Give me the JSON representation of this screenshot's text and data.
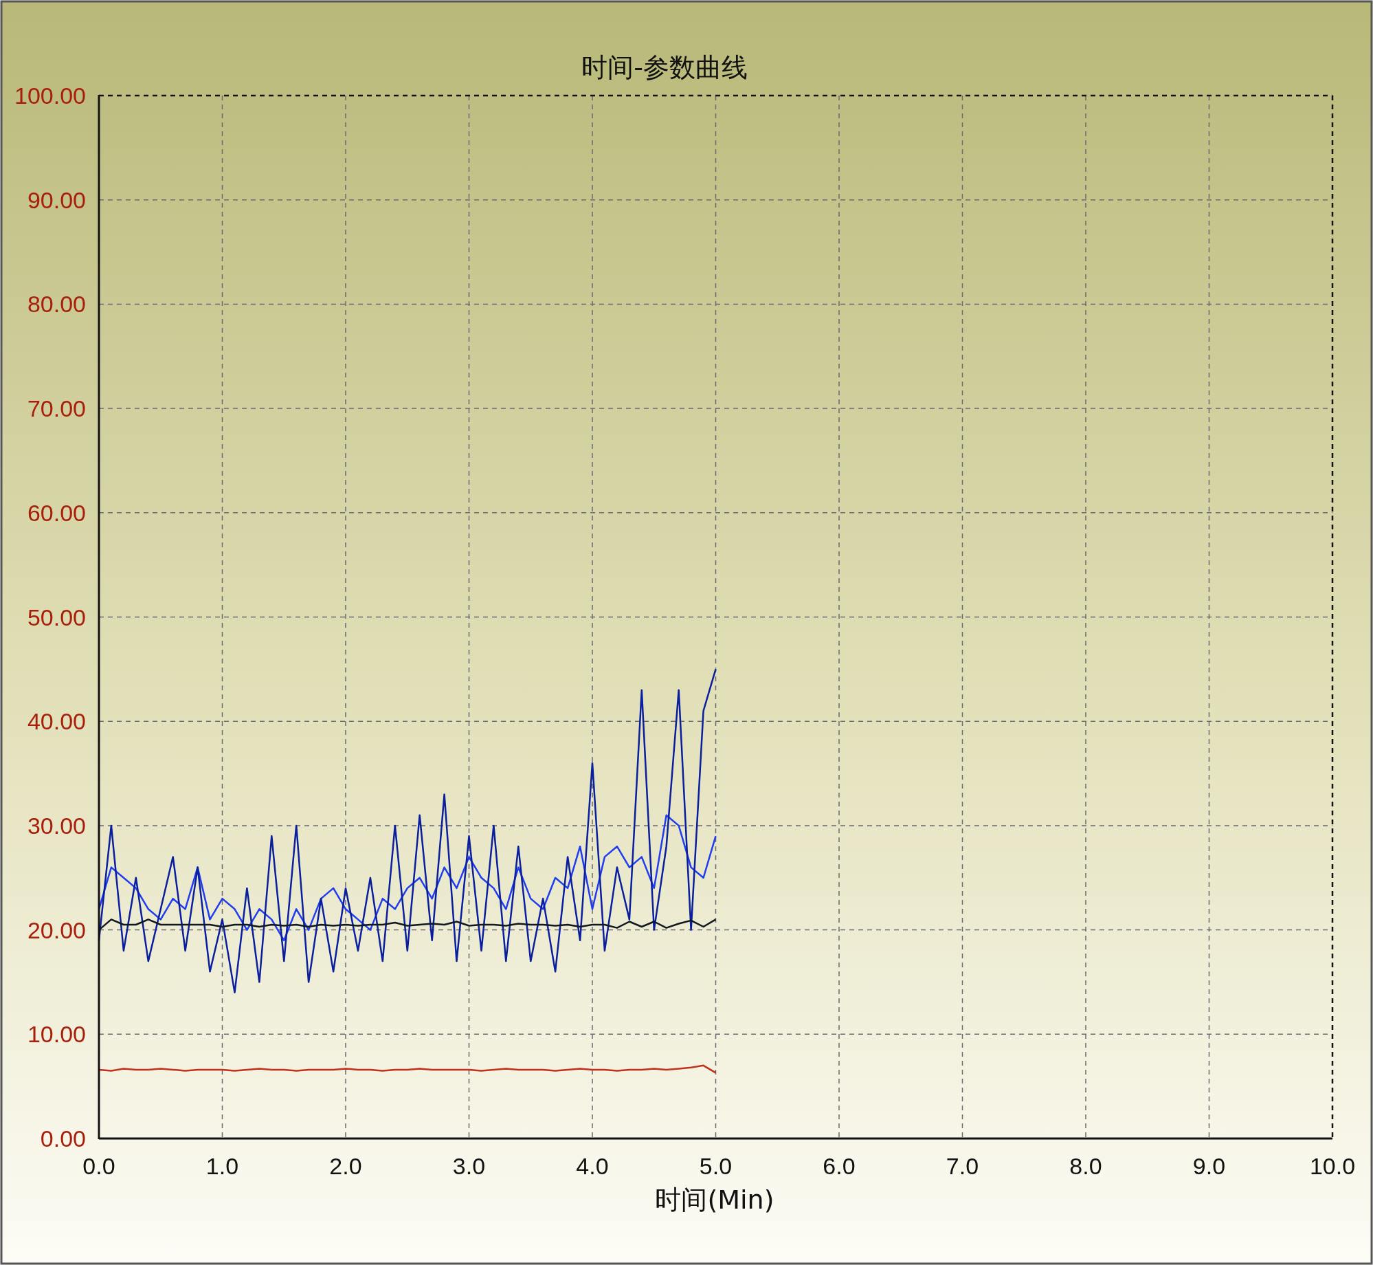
{
  "chart_data": {
    "type": "line",
    "title": "时间-参数曲线",
    "xlabel": "时间(Min)",
    "x": [
      0.0,
      0.1,
      0.2,
      0.3,
      0.4,
      0.5,
      0.6,
      0.7,
      0.8,
      0.9,
      1.0,
      1.1,
      1.2,
      1.3,
      1.4,
      1.5,
      1.6,
      1.7,
      1.8,
      1.9,
      2.0,
      2.1,
      2.2,
      2.3,
      2.4,
      2.5,
      2.6,
      2.7,
      2.8,
      2.9,
      3.0,
      3.1,
      3.2,
      3.3,
      3.4,
      3.5,
      3.6,
      3.7,
      3.8,
      3.9,
      4.0,
      4.1,
      4.2,
      4.3,
      4.4,
      4.5,
      4.6,
      4.7,
      4.8,
      4.9,
      5.0
    ],
    "series": [
      {
        "color": "#1f3cf0",
        "values": [
          22,
          26,
          25,
          24,
          22,
          21,
          23,
          22,
          26,
          21,
          23,
          22,
          20,
          22,
          21,
          19,
          22,
          20,
          23,
          24,
          22,
          21,
          20,
          23,
          22,
          24,
          25,
          23,
          26,
          24,
          27,
          25,
          24,
          22,
          26,
          23,
          22,
          25,
          24,
          28,
          22,
          27,
          28,
          26,
          27,
          24,
          31,
          30,
          26,
          25,
          29
        ]
      },
      {
        "color": "#0a1f9e",
        "values": [
          19,
          30,
          18,
          25,
          17,
          22,
          27,
          18,
          26,
          16,
          21,
          14,
          24,
          15,
          29,
          17,
          30,
          15,
          23,
          16,
          24,
          18,
          25,
          17,
          30,
          18,
          31,
          19,
          33,
          17,
          29,
          18,
          30,
          17,
          28,
          17,
          23,
          16,
          27,
          19,
          36,
          18,
          26,
          21,
          43,
          20,
          28,
          43,
          20,
          41,
          45
        ]
      },
      {
        "color": "#101820",
        "values": [
          20,
          21,
          20.5,
          20.5,
          21,
          20.5,
          20.5,
          20.5,
          20.5,
          20.5,
          20.3,
          20.5,
          20.5,
          20.3,
          20.5,
          20.4,
          20.5,
          20.3,
          20.5,
          20.4,
          20.5,
          20.4,
          20.5,
          20.5,
          20.7,
          20.4,
          20.5,
          20.6,
          20.5,
          20.8,
          20.4,
          20.5,
          20.5,
          20.4,
          20.6,
          20.5,
          20.5,
          20.4,
          20.5,
          20.3,
          20.5,
          20.5,
          20.2,
          20.8,
          20.3,
          20.8,
          20.2,
          20.6,
          20.9,
          20.3,
          21
        ]
      },
      {
        "color": "#c0301c",
        "values": [
          6.6,
          6.5,
          6.7,
          6.6,
          6.6,
          6.7,
          6.6,
          6.5,
          6.6,
          6.6,
          6.6,
          6.5,
          6.6,
          6.7,
          6.6,
          6.6,
          6.5,
          6.6,
          6.6,
          6.6,
          6.7,
          6.6,
          6.6,
          6.5,
          6.6,
          6.6,
          6.7,
          6.6,
          6.6,
          6.6,
          6.6,
          6.5,
          6.6,
          6.7,
          6.6,
          6.6,
          6.6,
          6.5,
          6.6,
          6.7,
          6.6,
          6.6,
          6.5,
          6.6,
          6.6,
          6.7,
          6.6,
          6.7,
          6.8,
          7.0,
          6.3
        ]
      }
    ],
    "grid": true,
    "xlim": [
      0,
      10
    ],
    "ylim": [
      0,
      100
    ],
    "xticks": [
      {
        "value": 0,
        "label": "0.0"
      },
      {
        "value": 1,
        "label": "1.0"
      },
      {
        "value": 2,
        "label": "2.0"
      },
      {
        "value": 3,
        "label": "3.0"
      },
      {
        "value": 4,
        "label": "4.0"
      },
      {
        "value": 5,
        "label": "5.0"
      },
      {
        "value": 6,
        "label": "6.0"
      },
      {
        "value": 7,
        "label": "7.0"
      },
      {
        "value": 8,
        "label": "8.0"
      },
      {
        "value": 9,
        "label": "9.0"
      },
      {
        "value": 10,
        "label": "10.0"
      }
    ],
    "yticks": [
      {
        "value": 0,
        "label": "0.00"
      },
      {
        "value": 10,
        "label": "10.00"
      },
      {
        "value": 20,
        "label": "20.00"
      },
      {
        "value": 30,
        "label": "30.00"
      },
      {
        "value": 40,
        "label": "40.00"
      },
      {
        "value": 50,
        "label": "50.00"
      },
      {
        "value": 60,
        "label": "60.00"
      },
      {
        "value": 70,
        "label": "70.00"
      },
      {
        "value": 80,
        "label": "80.00"
      },
      {
        "value": 90,
        "label": "90.00"
      },
      {
        "value": 100,
        "label": "100.00"
      }
    ]
  }
}
